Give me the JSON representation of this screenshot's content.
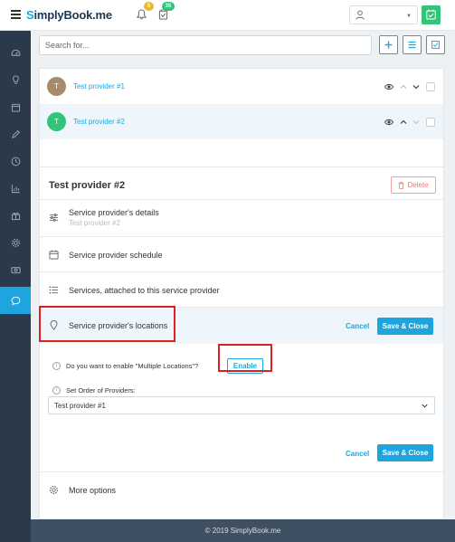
{
  "header": {
    "logo_first": "S",
    "logo_rest": "implyBook.me",
    "notifications_count": "5",
    "tasks_count": "35",
    "user_name": ""
  },
  "search": {
    "placeholder": "Search for..."
  },
  "providers": [
    {
      "initial": "T",
      "name": "Test provider #1",
      "avatar_color": "#a58c6b"
    },
    {
      "initial": "T",
      "name": "Test provider #2",
      "avatar_color": "#33c47a"
    }
  ],
  "panel": {
    "title": "Test provider #2",
    "delete_label": "Delete",
    "sections": {
      "details": {
        "label": "Service provider's details",
        "sub": "Test provider #2"
      },
      "schedule": {
        "label": "Service provider schedule"
      },
      "services": {
        "label": "Services, attached to this service provider"
      },
      "locations": {
        "label": "Service provider's locations"
      },
      "more": {
        "label": "More options"
      }
    },
    "cancel_label": "Cancel",
    "save_close_label": "Save & Close",
    "multiple_locations_question": "Do you want to enable \"Multiple Locations\"?",
    "enable_label": "Enable",
    "set_order_label": "Set Order of Providers:",
    "order_selected": "Test provider #1"
  },
  "footer": {
    "copyright": "© 2019 SimplyBook.me"
  },
  "colors": {
    "accent": "#1ea5e0",
    "sidebar": "#2b3a4a",
    "success": "#33c47a",
    "danger": "#e57b7b",
    "highlight": "#e02020"
  }
}
